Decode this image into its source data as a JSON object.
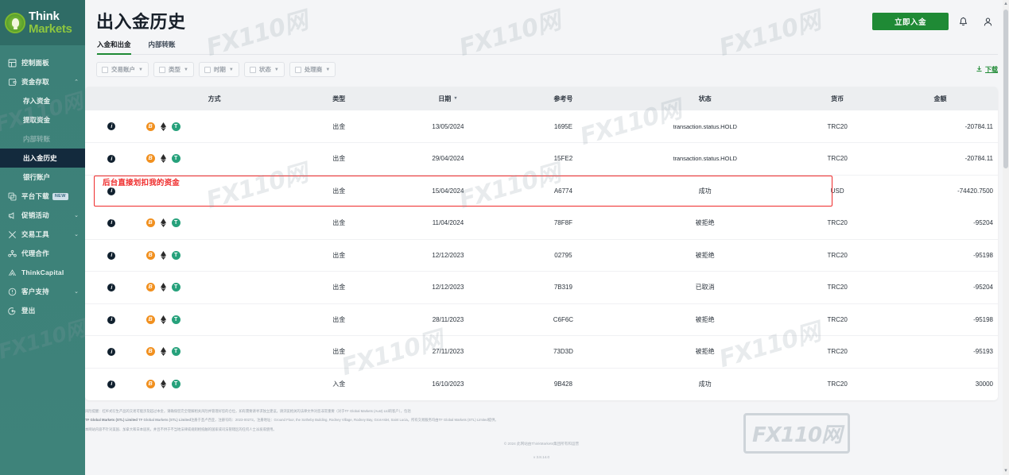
{
  "sidebar": {
    "logo": {
      "line1": "Think",
      "line2": "Markets",
      "icon": "lightbulb-icon"
    },
    "items": [
      {
        "label": "控制面板",
        "icon": "dashboard-icon",
        "type": "item",
        "expandable": false
      },
      {
        "label": "资金存取",
        "icon": "wallet-icon",
        "type": "item",
        "expandable": true,
        "expanded": true,
        "caret": "⌃"
      },
      {
        "label": "存入资金",
        "type": "sub",
        "state": "normal"
      },
      {
        "label": "提取资金",
        "type": "sub",
        "state": "normal"
      },
      {
        "label": "内部转账",
        "type": "sub",
        "state": "muted"
      },
      {
        "label": "出入金历史",
        "type": "sub",
        "state": "active"
      },
      {
        "label": "银行账户",
        "type": "sub",
        "state": "normal"
      },
      {
        "label": "平台下载",
        "icon": "download-platform-icon",
        "type": "item",
        "badge": "NEW"
      },
      {
        "label": "促销活动",
        "icon": "megaphone-icon",
        "type": "item",
        "expandable": true,
        "caret": "⌄"
      },
      {
        "label": "交易工具",
        "icon": "tools-icon",
        "type": "item",
        "expandable": true,
        "caret": "⌄"
      },
      {
        "label": "代理合作",
        "icon": "partners-icon",
        "type": "item",
        "expandable": false
      },
      {
        "label": "ThinkCapital",
        "icon": "capital-icon",
        "type": "item",
        "expandable": false
      },
      {
        "label": "客户支持",
        "icon": "support-icon",
        "type": "item",
        "expandable": true,
        "caret": "⌄"
      },
      {
        "label": "登出",
        "icon": "logout-icon",
        "type": "item",
        "expandable": false
      }
    ]
  },
  "header": {
    "title": "出入金历史",
    "deposit_button": "立即入金",
    "bell_icon": "bell-icon",
    "account_icon": "user-icon"
  },
  "tabs": [
    {
      "label": "入金和出金",
      "active": true
    },
    {
      "label": "内部转账",
      "active": false
    }
  ],
  "filters": [
    {
      "label": "交易账户"
    },
    {
      "label": "类型"
    },
    {
      "label": "时期"
    },
    {
      "label": "状态"
    },
    {
      "label": "处理商"
    }
  ],
  "download": {
    "label": "下载",
    "icon": "download-icon"
  },
  "table": {
    "columns": [
      "",
      "方式",
      "类型",
      "日期",
      "参考号",
      "状态",
      "货币",
      "金额"
    ],
    "sort_column": "日期",
    "rows": [
      {
        "methods": [
          "btc",
          "eth",
          "usdt"
        ],
        "type": "出金",
        "date": "13/05/2024",
        "ref": "1695E",
        "status": "transaction.status.HOLD",
        "currency": "TRC20",
        "amount": "-20784.11",
        "flagged": false
      },
      {
        "methods": [
          "btc",
          "eth",
          "usdt"
        ],
        "type": "出金",
        "date": "29/04/2024",
        "ref": "15FE2",
        "status": "transaction.status.HOLD",
        "currency": "TRC20",
        "amount": "-20784.11",
        "flagged": false
      },
      {
        "methods": [],
        "type": "出金",
        "date": "15/04/2024",
        "ref": "A6774",
        "status": "成功",
        "currency": "USD",
        "amount": "-74420.7500",
        "flagged": true
      },
      {
        "methods": [
          "btc",
          "eth",
          "usdt"
        ],
        "type": "出金",
        "date": "11/04/2024",
        "ref": "78F8F",
        "status": "被拒绝",
        "currency": "TRC20",
        "amount": "-95204",
        "flagged": false
      },
      {
        "methods": [
          "btc",
          "eth",
          "usdt"
        ],
        "type": "出金",
        "date": "12/12/2023",
        "ref": "02795",
        "status": "被拒绝",
        "currency": "TRC20",
        "amount": "-95198",
        "flagged": false
      },
      {
        "methods": [
          "btc",
          "eth",
          "usdt"
        ],
        "type": "出金",
        "date": "12/12/2023",
        "ref": "7B319",
        "status": "已取消",
        "currency": "TRC20",
        "amount": "-95204",
        "flagged": false
      },
      {
        "methods": [
          "btc",
          "eth",
          "usdt"
        ],
        "type": "出金",
        "date": "28/11/2023",
        "ref": "C6F6C",
        "status": "被拒绝",
        "currency": "TRC20",
        "amount": "-95198",
        "flagged": false
      },
      {
        "methods": [
          "btc",
          "eth",
          "usdt"
        ],
        "type": "出金",
        "date": "27/11/2023",
        "ref": "73D3D",
        "status": "被拒绝",
        "currency": "TRC20",
        "amount": "-95193",
        "flagged": false
      },
      {
        "methods": [
          "btc",
          "eth",
          "usdt"
        ],
        "type": "入金",
        "date": "16/10/2023",
        "ref": "9B428",
        "status": "成功",
        "currency": "TRC20",
        "amount": "30000",
        "flagged": false
      }
    ]
  },
  "annotation": {
    "text": "后台直接划扣我的资金",
    "color": "#ef2b2b"
  },
  "footer": {
    "risk": "风险提醒：杠杆式衍生产品的交易可能涉及超过本金，请确保您完全理解相关风险并管理好您的仓位，如有需要请寻求独立建议。请浏览相关的法律文件对您非常重要（对于TF Global Markets (Aust) Ltd的客户），包括",
    "entity": "TF Global Markets (STL) Limited",
    "entity_rest": "<strong>TF Global Markets (STL) Limited</strong>注册于圣卢西亚，注册号码：2023-00272。注册地址：Ground Floor, the Sotheby Building, Rodney Village, Rodney Bay, Gros-Islet, Saint Lucia。所有交易服务均由TF Global Markets (STL) Limited提供。",
    "restriction": "本网站内容不针对美国、加拿大和日本居民，并且不供于不当地法律或规则相抵触的国家或司法管辖区的任何人士派发或使用。",
    "copyright": "© 2024 此网站由ThinkMarkets集团所有和运营",
    "version": "v 3.8.14.0"
  },
  "watermarks": {
    "text": "FX110网",
    "boxed": "FX110网"
  },
  "colors": {
    "sidebar_bg": "#3d8279",
    "sidebar_active": "#132a3d",
    "brand_green": "#1f8a35",
    "accent_green": "#8dc63f",
    "annotation_red": "#ef2b2b",
    "page_bg": "#f4f5f7"
  }
}
